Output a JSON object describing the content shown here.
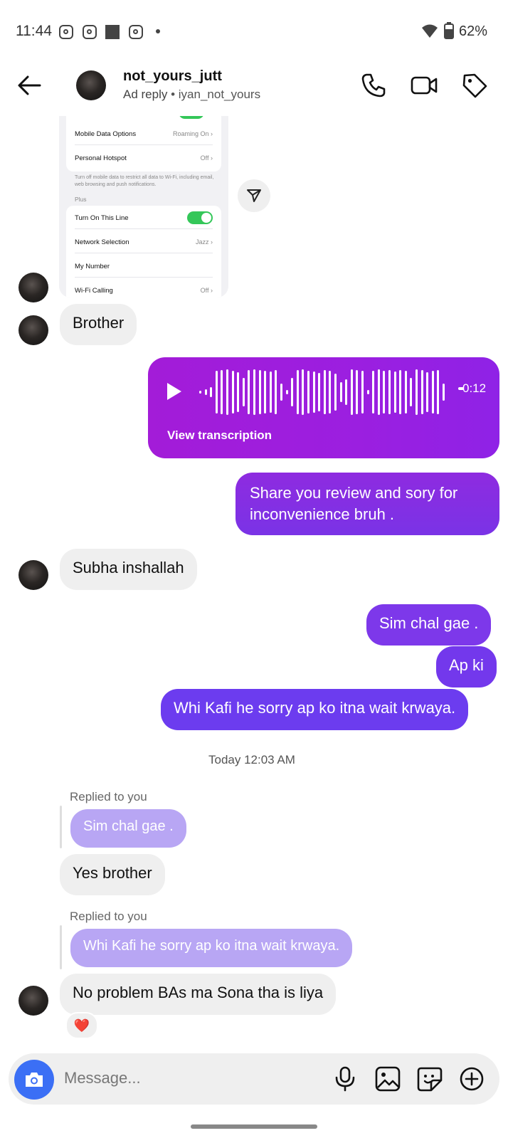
{
  "status_bar": {
    "time": "11:44",
    "battery": "62%"
  },
  "header": {
    "username": "not_yours_jutt",
    "subtitle_prefix": "Ad reply",
    "subtitle_handle": "iyan_not_yours"
  },
  "screenshot_card": {
    "rows_top": [
      {
        "label": "Mobile Data Options",
        "value": "Roaming On"
      },
      {
        "label": "Personal Hotspot",
        "value": "Off"
      }
    ],
    "note": "Turn off mobile data to restrict all data to Wi-Fi, including email, web browsing and push notifications.",
    "section_label": "Plus",
    "rows_bottom": [
      {
        "label": "Turn On This Line",
        "value": ""
      },
      {
        "label": "Network Selection",
        "value": "Jazz"
      },
      {
        "label": "My Number",
        "value": ""
      },
      {
        "label": "Wi-Fi Calling",
        "value": "Off"
      }
    ]
  },
  "messages": {
    "in_brother": "Brother",
    "voice_duration": "0:12",
    "voice_transcription": "View transcription",
    "out_share": "Share you review and sory for inconvenience bruh .",
    "in_subha": "Subha inshallah",
    "out_sim": "Sim chal gae .",
    "out_apki": "Ap ki",
    "out_whi": "Whi Kafi he sorry ap ko itna wait krwaya.",
    "timestamp": "Today 12:03 AM",
    "reply1_label": "Replied to you",
    "reply1_quote": "Sim chal gae .",
    "in_yes": "Yes brother",
    "reply2_label": "Replied to you",
    "reply2_quote": "Whi Kafi he sorry ap ko itna wait krwaya.",
    "in_noproblem": "No problem BAs ma Sona tha is liya",
    "reaction": "❤️"
  },
  "input_bar": {
    "placeholder": "Message..."
  },
  "colors": {
    "voice_purple": "#9b1fe0",
    "out_purple_top": "#8e2be0",
    "out_purple_bottom": "#6a3cf0",
    "reply_quote": "#b8a6f4",
    "camera_blue": "#3b6ff5"
  }
}
